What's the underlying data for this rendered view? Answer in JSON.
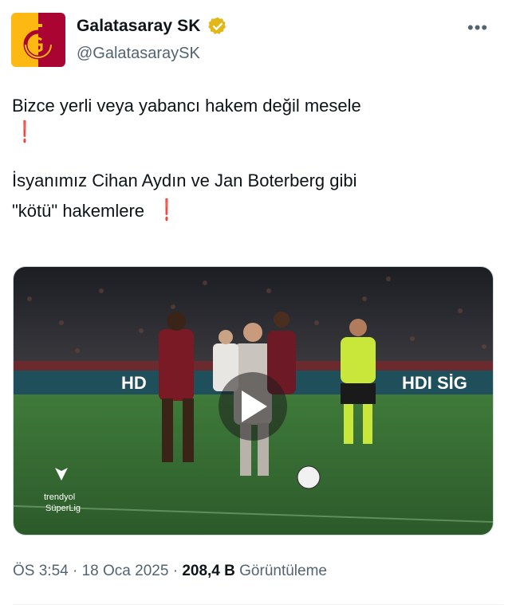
{
  "account": {
    "name": "Galatasaray SK",
    "handle": "@GalatasaraySK",
    "verified_icon": "gold-verified-badge",
    "brand_colors": {
      "red": "#a90432",
      "yellow": "#fdb912"
    }
  },
  "menu": {
    "more_icon": "•••"
  },
  "tweet": {
    "line1": "Bizce yerli veya yabancı hakem değil mesele",
    "line2": "İsyanımız Cihan Aydın ve Jan Boterberg gibi",
    "line3": "\"kötü\" hakemlere",
    "emoji": "❗"
  },
  "media": {
    "type": "video",
    "play_icon": "play-icon",
    "board_text": "HDI SİG",
    "board_text_left": "HD",
    "watermark_line1": "trendyol",
    "watermark_line2": "SüperLig"
  },
  "meta": {
    "time": "ÖS 3:54",
    "date": "18 Oca 2025",
    "views_count": "208,4 B",
    "views_label": "Görüntüleme",
    "sep": "·"
  }
}
